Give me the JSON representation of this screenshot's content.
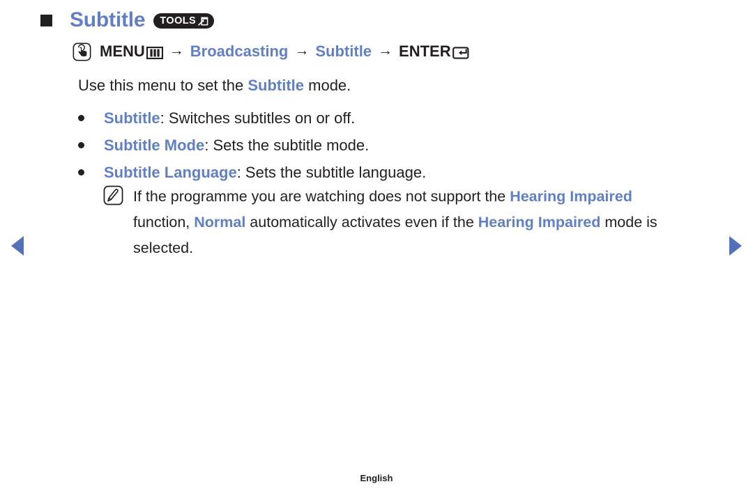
{
  "title": {
    "text": "Subtitle",
    "badge_label": "TOOLS",
    "badge_icon": "tools-shortcut-icon",
    "bullet_icon": "square-bullet-icon"
  },
  "menu_path": {
    "hand_icon": "hand-press-icon",
    "menu_label": "MENU",
    "menu_icon": "menu-grid-icon",
    "arrow1": "→",
    "step1": "Broadcasting",
    "arrow2": "→",
    "step2": "Subtitle",
    "arrow3": "→",
    "enter_label": "ENTER",
    "enter_icon": "enter-key-icon"
  },
  "intro": {
    "prefix": "Use this menu to set the ",
    "term": "Subtitle",
    "suffix": " mode."
  },
  "bullets": [
    {
      "term": "Subtitle",
      "rest": ": Switches subtitles on or off."
    },
    {
      "term": "Subtitle Mode",
      "rest": ": Sets the subtitle mode."
    },
    {
      "term": "Subtitle Language",
      "rest": ": Sets the subtitle language."
    }
  ],
  "note": {
    "icon": "note-pen-icon",
    "seg1": "If the programme you are watching does not support the ",
    "term1": "Hearing Impaired",
    "seg2": " function, ",
    "term2": "Normal",
    "seg3": " automatically activates even if the ",
    "term3": "Hearing Impaired",
    "seg4": " mode is selected."
  },
  "nav": {
    "prev_label": "previous-page-arrow",
    "next_label": "next-page-arrow"
  },
  "footer": {
    "language": "English"
  },
  "colors": {
    "accent_blue": "#6180c4",
    "arrow_blue": "#5271b8",
    "text_dark": "#231f20"
  }
}
